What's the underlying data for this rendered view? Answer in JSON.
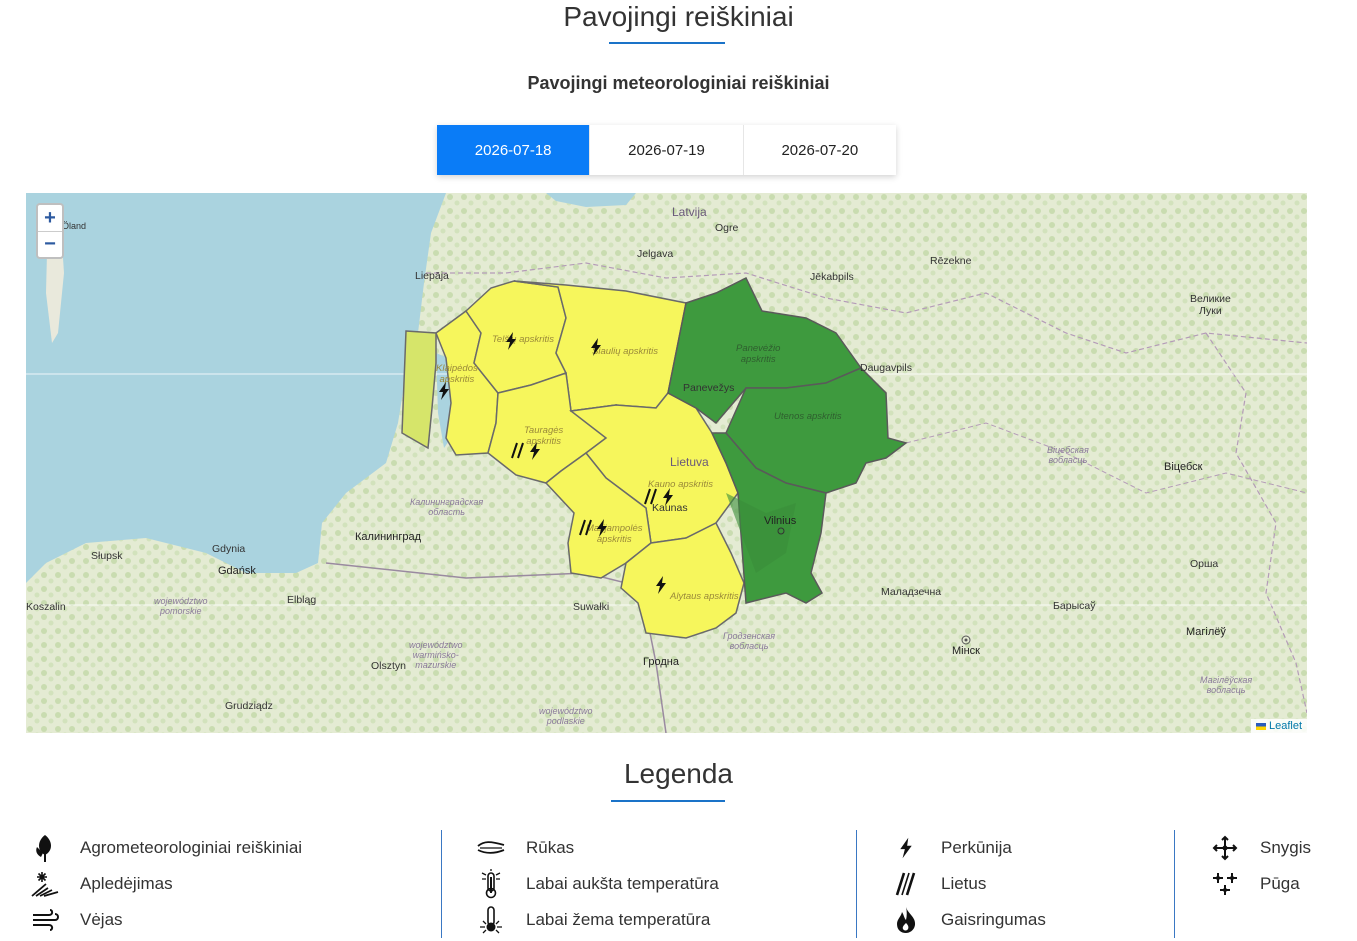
{
  "page": {
    "title": "Pavojingi reiškiniai",
    "subtitle": "Pavojingi meteorologiniai reiškiniai"
  },
  "date_tabs": [
    {
      "label": "2026-07-18",
      "active": true
    },
    {
      "label": "2026-07-19",
      "active": false
    },
    {
      "label": "2026-07-20",
      "active": false
    }
  ],
  "map": {
    "zoom_in": "+",
    "zoom_out": "−",
    "attribution": "Leaflet",
    "colors": {
      "yellow_warning": "#f6f65c",
      "green_ok": "#3e9a3e",
      "coastal": "#d6e56a",
      "water": "#aad3df"
    },
    "labels": {
      "latvija": "Latvija",
      "lietuva": "Lietuva",
      "liepaja": "Liepāja",
      "jelgava": "Jelgava",
      "ogre": "Ogre",
      "jekabpils": "Jēkabpils",
      "rezekne": "Rēzekne",
      "daugavpils": "Daugavpils",
      "velikie_luki": "Великие\nЛуки",
      "oland": "Öland",
      "panevezys": "Panevežys",
      "kaunas": "Kaunas",
      "vilnius": "Vilnius",
      "kaliningrad": "Калининград",
      "kaliningrad_obl": "Калининградская\nобласть",
      "gdynia": "Gdynia",
      "gdansk": "Gdańsk",
      "slupsk": "Słupsk",
      "elblag": "Elbląg",
      "koszalin": "Koszalin",
      "olsztyn": "Olsztyn",
      "grudziadz": "Grudziądz",
      "suwalki": "Suwałki",
      "grodna": "Гродна",
      "grodno_obl": "Гродзенская\nвобласць",
      "maladzechna": "Маладзечна",
      "minsk": "Мінск",
      "vitebsk": "Віцебск",
      "vitebsk_obl": "Віцебская\nвобласць",
      "orsha": "Орша",
      "barysau": "Барысаў",
      "mahilyou": "Магілёў",
      "mahilyou_obl": "Магілёўская\nвобласць",
      "pomorskie": "województwo\npomorskie",
      "warminsko": "województwo\nwarmińsko-\nmazurskie",
      "podlaskie": "województwo\npodlaskie",
      "telsiu": "Telšių apskritis",
      "siauliu": "Šiaulių apskritis",
      "klaipedos": "Klaipėdos\napskritis",
      "taurages": "Tauragės\napskritis",
      "kauno": "Kauno apskritis",
      "marijampoles": "Marijampolės\napskritis",
      "alytaus": "Alytaus apskritis",
      "panevezio": "Panevėžio\napskritis",
      "utenos": "Utenos apskritis"
    }
  },
  "legend": {
    "title": "Legenda",
    "items": [
      {
        "label": "Agrometeorologiniai reiškiniai",
        "icon": "leaf-icon"
      },
      {
        "label": "Apledėjimas",
        "icon": "icing-icon"
      },
      {
        "label": "Vėjas",
        "icon": "wind-icon"
      },
      {
        "label": "Rūkas",
        "icon": "fog-icon"
      },
      {
        "label": "Labai aukšta temperatūra",
        "icon": "high-temperature-icon"
      },
      {
        "label": "Labai žema temperatūra",
        "icon": "low-temperature-icon"
      },
      {
        "label": "Perkūnija",
        "icon": "lightning-icon"
      },
      {
        "label": "Lietus",
        "icon": "rain-icon"
      },
      {
        "label": "Gaisringumas",
        "icon": "fire-icon"
      },
      {
        "label": "Snygis",
        "icon": "snowflake-icon"
      },
      {
        "label": "Pūga",
        "icon": "blizzard-icon"
      }
    ]
  }
}
